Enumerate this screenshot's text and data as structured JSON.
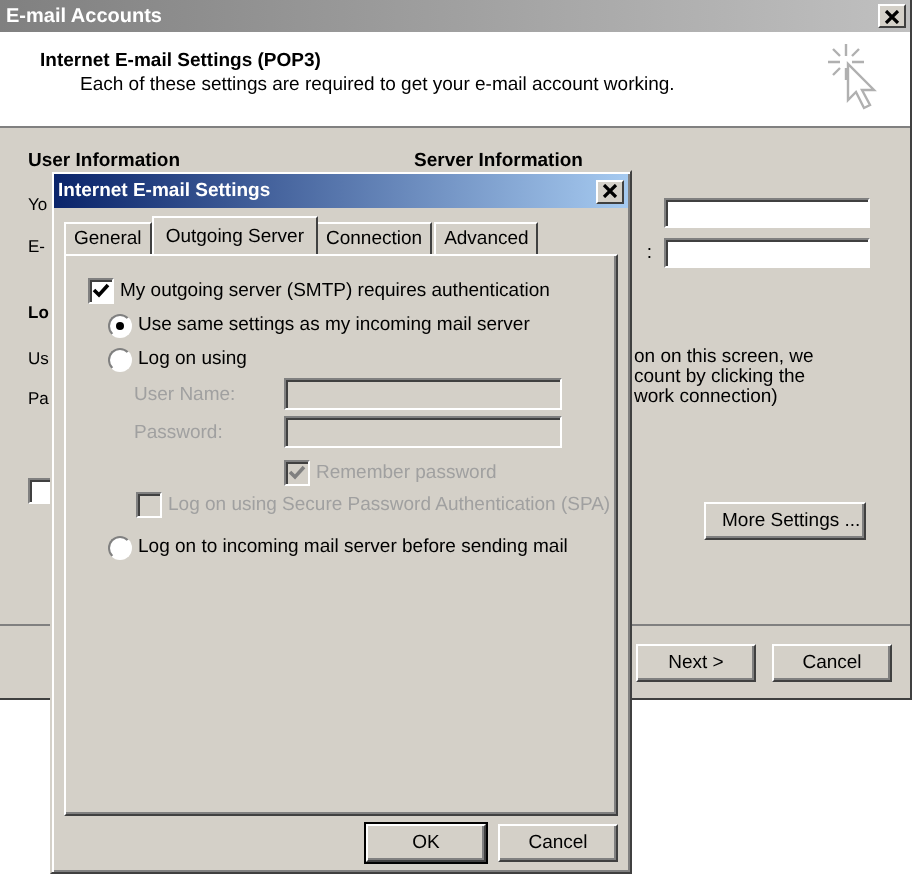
{
  "back_window": {
    "title": "E-mail Accounts",
    "header_title": "Internet E-mail Settings (POP3)",
    "header_subtitle": "Each of these settings are required to get your e-mail account working.",
    "sections": [
      "User Information",
      "Server Information"
    ],
    "left_labels": [
      {
        "text": "Yo",
        "kind": "label"
      },
      {
        "text": "E-",
        "kind": "label"
      },
      {
        "text": "Lo",
        "kind": "heading"
      },
      {
        "text": "Us",
        "kind": "label"
      },
      {
        "text": "Pa",
        "kind": "label"
      }
    ],
    "left_checkbox": {
      "checked": false
    },
    "server_fields": [
      {
        "kind": "text"
      },
      {
        "kind": "text",
        "label": ":"
      }
    ],
    "note_lines": [
      "on on this screen, we",
      "count by clicking the",
      "work connection)"
    ],
    "more_settings_button": "More Settings ...",
    "buttons": [
      "Next >",
      "Cancel"
    ]
  },
  "dialog": {
    "title": "Internet E-mail Settings",
    "tabs": [
      {
        "label": "General",
        "selected": false
      },
      {
        "label": "Outgoing Server",
        "selected": true
      },
      {
        "label": "Connection",
        "selected": false
      },
      {
        "label": "Advanced",
        "selected": false
      }
    ],
    "smtp_auth": {
      "label": "My outgoing server (SMTP) requires authentication",
      "checked": true
    },
    "radios": [
      {
        "label": "Use same settings as my incoming mail server",
        "selected": true
      },
      {
        "label": "Log on using",
        "selected": false
      },
      {
        "label": "Log on to incoming mail server before sending mail",
        "selected": false
      }
    ],
    "credentials": [
      {
        "label": "User Name:",
        "disabled": true
      },
      {
        "label": "Password:",
        "disabled": true
      }
    ],
    "remember_password": {
      "label": "Remember password",
      "checked": true,
      "disabled": true
    },
    "spa": {
      "label": "Log on using Secure Password Authentication (SPA)",
      "checked": false,
      "disabled": true
    },
    "buttons": [
      "OK",
      "Cancel"
    ]
  }
}
